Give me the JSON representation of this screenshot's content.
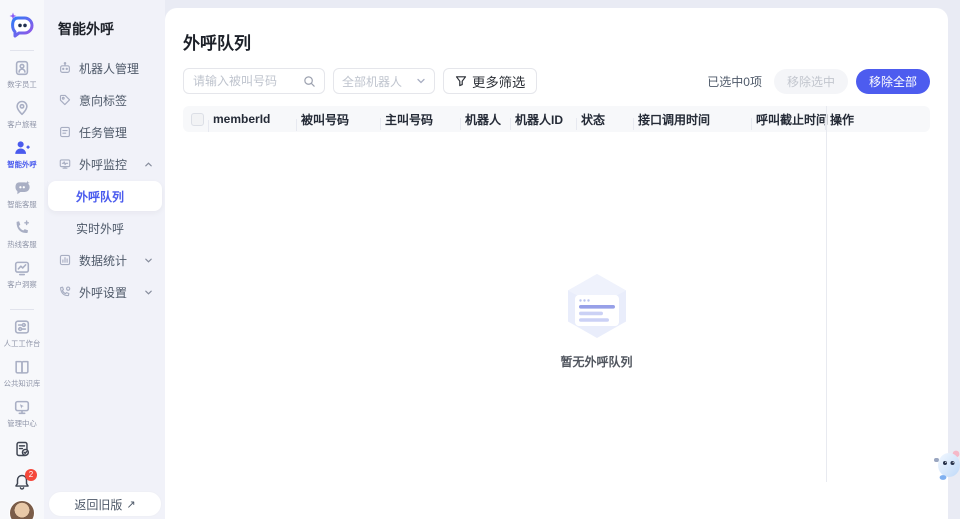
{
  "colors": {
    "primary": "#4D5CEF",
    "active_text": "#4A5BEE",
    "page_bg": "#E9EBF4",
    "badge_red": "#F5483B",
    "table_header_bg": "#F7F8FA"
  },
  "rail": {
    "items": [
      {
        "label": "数字员工",
        "icon": "digital-employee-icon",
        "active": false
      },
      {
        "label": "客户旅程",
        "icon": "customer-journey-icon",
        "active": false
      },
      {
        "label": "智能外呼",
        "icon": "smart-outbound-icon",
        "active": true
      },
      {
        "label": "智能客服",
        "icon": "smart-service-icon",
        "active": false
      },
      {
        "label": "热线客服",
        "icon": "hotline-service-icon",
        "active": false
      },
      {
        "label": "客户洞察",
        "icon": "customer-insight-icon",
        "active": false
      },
      {
        "label": "人工工作台",
        "icon": "workbench-icon",
        "active": false
      },
      {
        "label": "公共知识库",
        "icon": "knowledge-base-icon",
        "active": false
      },
      {
        "label": "管理中心",
        "icon": "admin-center-icon",
        "active": false
      }
    ],
    "notification_count": "2"
  },
  "sidebar": {
    "title": "智能外呼",
    "items": [
      {
        "label": "机器人管理"
      },
      {
        "label": "意向标签"
      },
      {
        "label": "任务管理"
      },
      {
        "label": "外呼监控",
        "expanded": true
      },
      {
        "label": "外呼队列",
        "sub": true,
        "active": true
      },
      {
        "label": "实时外呼",
        "sub": true
      },
      {
        "label": "数据统计",
        "expanded": false
      },
      {
        "label": "外呼设置",
        "expanded": false
      }
    ],
    "back_button_label": "返回旧版",
    "back_button_arrow": "↗"
  },
  "main": {
    "title": "外呼队列",
    "toolbar": {
      "search_placeholder": "请输入被叫号码",
      "robot_filter_value": "全部机器人",
      "more_filters_label": "更多筛选",
      "selected_info": "已选中0项",
      "remove_selected_label": "移除选中",
      "remove_all_label": "移除全部"
    },
    "table": {
      "columns": [
        "memberId",
        "被叫号码",
        "主叫号码",
        "机器人",
        "机器人ID",
        "状态",
        "接口调用时间",
        "呼叫截止时间",
        "操作"
      ],
      "rows": [],
      "empty_text": "暂无外呼队列"
    }
  }
}
